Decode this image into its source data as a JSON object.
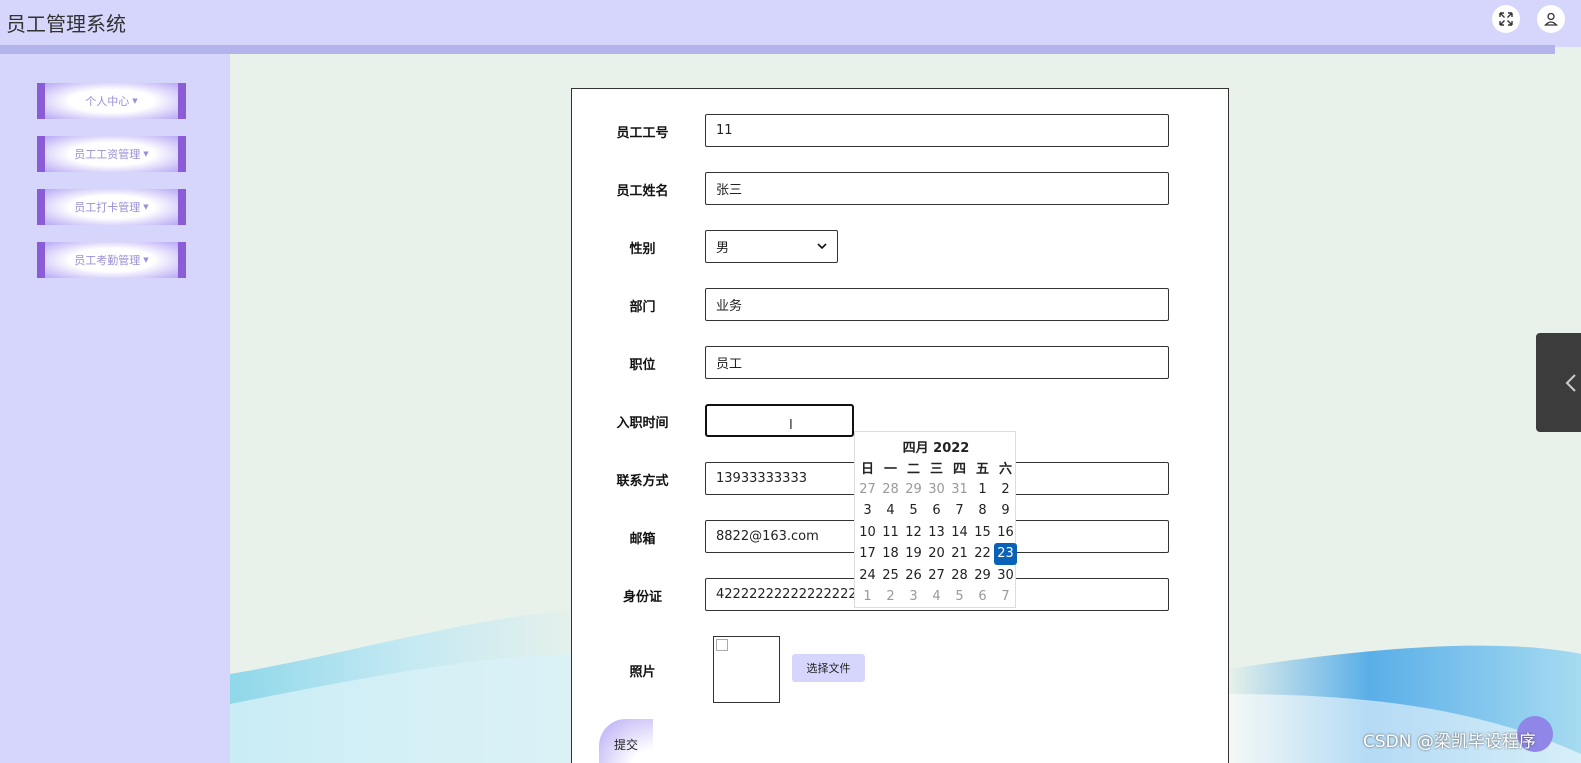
{
  "app": {
    "title": "员工管理系统"
  },
  "header": {
    "expand_icon": "expand-icon",
    "user_icon": "user-icon"
  },
  "sidebar": {
    "items": [
      {
        "label": "个人中心"
      },
      {
        "label": "员工工资管理"
      },
      {
        "label": "员工打卡管理"
      },
      {
        "label": "员工考勤管理"
      }
    ]
  },
  "form": {
    "fields": {
      "emp_no": {
        "label": "员工工号",
        "value": "11"
      },
      "name": {
        "label": "员工姓名",
        "value": "张三"
      },
      "gender": {
        "label": "性别",
        "value": "男"
      },
      "department": {
        "label": "部门",
        "value": "业务"
      },
      "position": {
        "label": "职位",
        "value": "员工"
      },
      "hire_date": {
        "label": "入职时间",
        "value": ""
      },
      "phone": {
        "label": "联系方式",
        "value": "13933333333"
      },
      "email": {
        "label": "邮箱",
        "value": "8822@163.com"
      },
      "id_card": {
        "label": "身份证",
        "value": "42222222222222222"
      },
      "photo": {
        "label": "照片",
        "file_button": "选择文件"
      }
    },
    "submit_label": "提交"
  },
  "calendar": {
    "title": "四月 2022",
    "weekdays": [
      "日",
      "一",
      "二",
      "三",
      "四",
      "五",
      "六"
    ],
    "weeks": [
      [
        "27",
        "28",
        "29",
        "30",
        "31",
        "1",
        "2"
      ],
      [
        "3",
        "4",
        "5",
        "6",
        "7",
        "8",
        "9"
      ],
      [
        "10",
        "11",
        "12",
        "13",
        "14",
        "15",
        "16"
      ],
      [
        "17",
        "18",
        "19",
        "20",
        "21",
        "22",
        "23"
      ],
      [
        "24",
        "25",
        "26",
        "27",
        "28",
        "29",
        "30"
      ],
      [
        "1",
        "2",
        "3",
        "4",
        "5",
        "6",
        "7"
      ]
    ],
    "selected": "23"
  },
  "watermark": "CSDN @梁凯毕设程序",
  "colors": {
    "topbar": "#d6d6fd",
    "sidebar_accent": "#8a5cd6",
    "calendar_selected": "#0a62b8"
  }
}
